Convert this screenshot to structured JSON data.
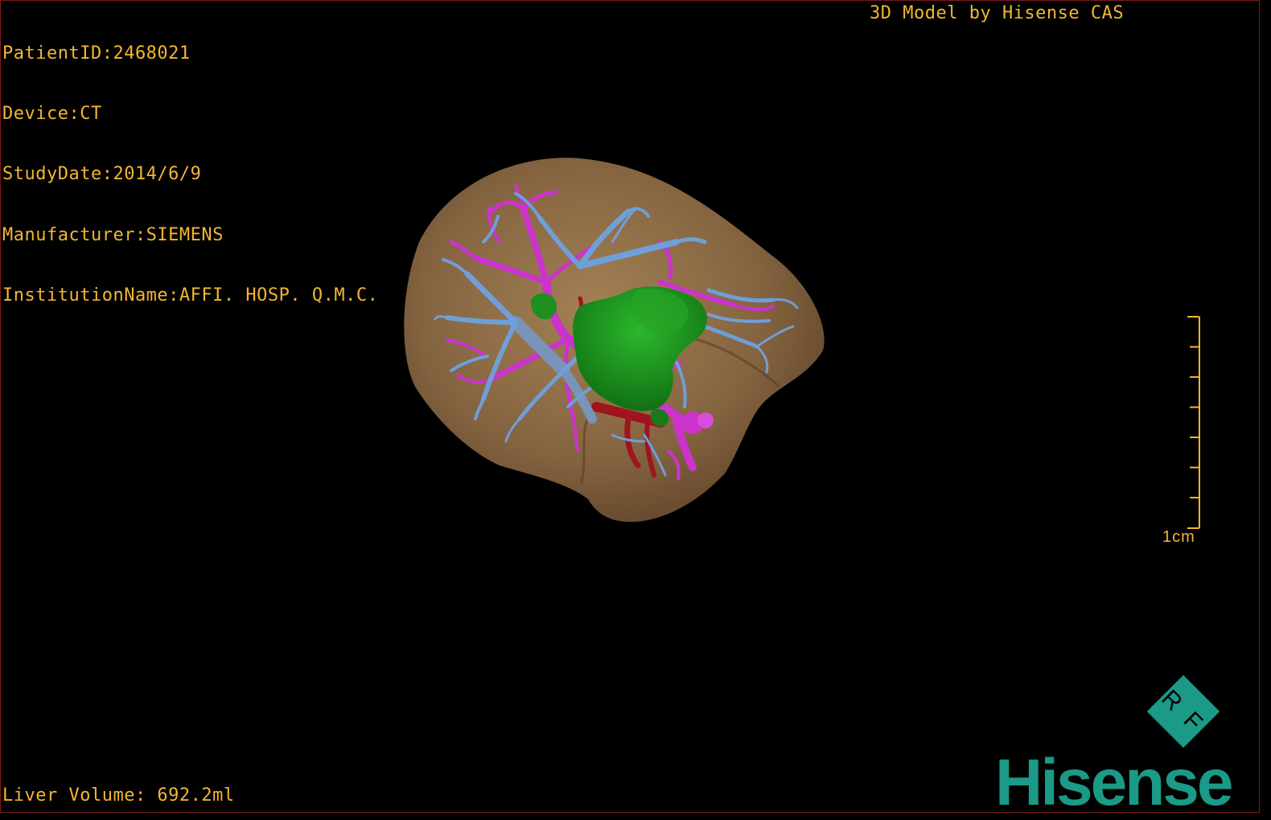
{
  "overlay": {
    "patient_id": "PatientID:2468021",
    "device": "Device:CT",
    "study_date": "StudyDate:2014/6/9",
    "manufacturer": "Manufacturer:SIEMENS",
    "institution": "InstitutionName:AFFI. HOSP. Q.M.C.",
    "credit": "3D Model by Hisense CAS",
    "liver_volume": "Liver Volume: 692.2ml"
  },
  "scale_bar": {
    "label": "1cm"
  },
  "logo": {
    "rf_letters": "RF",
    "brand": "Hisense"
  },
  "colors": {
    "text": "#f2b632",
    "liver": "#8a6a44",
    "portal_vein": "#cc33cc",
    "hepatic_vein": "#6f9fd8",
    "tumor": "#1f8f1f",
    "artery": "#a0141e",
    "brand": "#1b9a87"
  }
}
